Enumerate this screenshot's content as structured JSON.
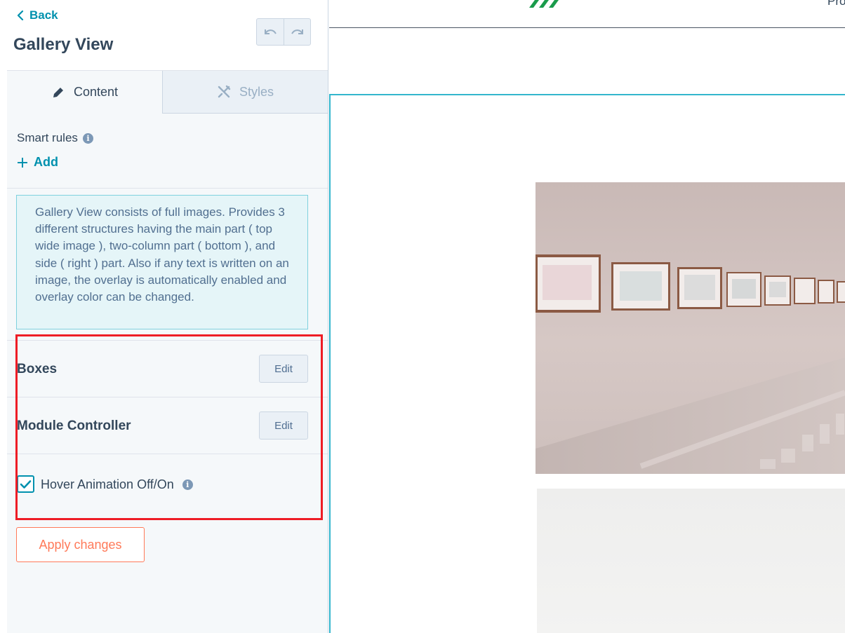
{
  "sidebar": {
    "back_label": "Back",
    "title": "Gallery View",
    "tabs": [
      {
        "label": "Content",
        "icon": "pencil-icon",
        "active": true
      },
      {
        "label": "Styles",
        "icon": "styles-icon",
        "active": false
      }
    ],
    "smart_rules_label": "Smart rules",
    "add_label": "Add",
    "description": "Gallery View consists of full images. Provides 3 different structures having the main part ( top wide image ), two-column part ( bottom ), and side ( right ) part. Also if any text is written on an image, the overlay is automatically enabled and overlay color can be changed.",
    "fields": [
      {
        "label": "Boxes",
        "button": "Edit"
      },
      {
        "label": "Module Controller",
        "button": "Edit"
      }
    ],
    "hover_animation": {
      "label": "Hover Animation Off/On",
      "checked": true
    },
    "apply_label": "Apply changes"
  },
  "preview": {
    "top_right_text": "Pro",
    "logo_color": "#1a9b4b",
    "frame_color": "#33b6cd"
  },
  "colors": {
    "accent": "#0091ae",
    "apply": "#ff7a59",
    "highlight": "#ee1c25"
  }
}
